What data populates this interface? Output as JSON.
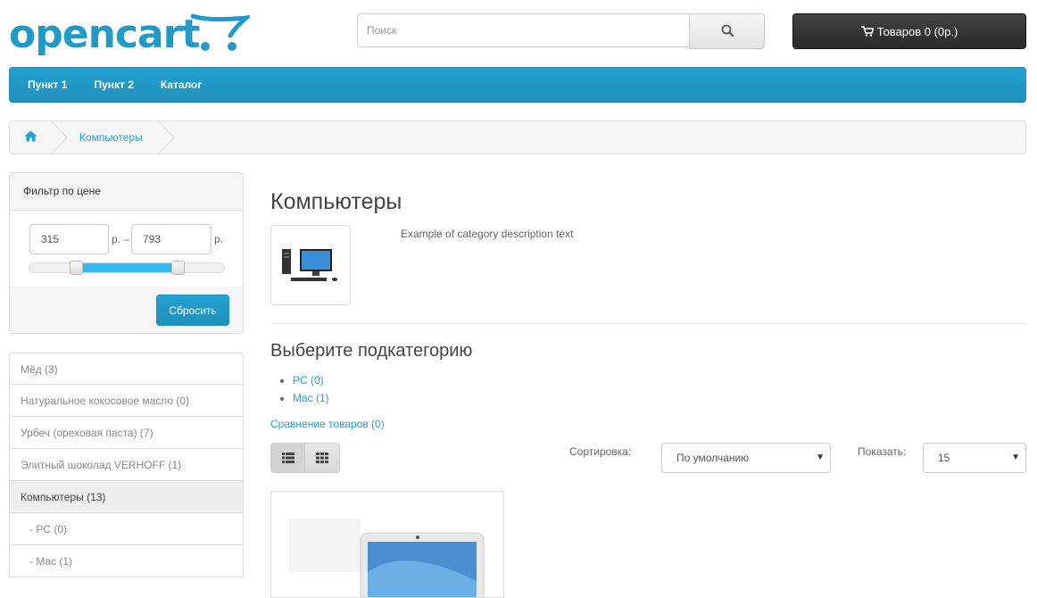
{
  "header": {
    "logo_text": "opencart",
    "search_placeholder": "Поиск",
    "cart_label": "Товаров 0 (0р.)"
  },
  "menu": {
    "items": [
      "Пункт 1",
      "Пункт 2",
      "Каталог"
    ]
  },
  "breadcrumb": {
    "current": "Компьютеры"
  },
  "price_filter": {
    "title": "Фильтр по цене",
    "min": "315",
    "max": "793",
    "unit_min": "р. –",
    "unit_max": "р.",
    "reset_label": "Сбросить",
    "slider_low_fraction": 0.24,
    "slider_high_fraction": 0.76
  },
  "categories": [
    "Мёд (3)",
    "Натуральное кокосовое масло (0)",
    "Урбеч (ореховая паста) (7)",
    "Элитный шоколад VERHOFF (1)",
    "Компьютеры (13)",
    "- PC (0)",
    "- Mac (1)"
  ],
  "main": {
    "title": "Компьютеры",
    "description": "Example of category description text",
    "subcategory_title": "Выберите подкатегорию",
    "subcategories": [
      "PC (0)",
      "Mac (1)"
    ],
    "compare_link": "Сравнение товаров (0)",
    "sort_label": "Сортировка:",
    "sort_value": "По умолчанию",
    "limit_label": "Показать:",
    "limit_value": "15"
  },
  "colors": {
    "brand": "#229ac8",
    "menu": "#23a1d1",
    "slider_fill": "#2fbbf0"
  }
}
